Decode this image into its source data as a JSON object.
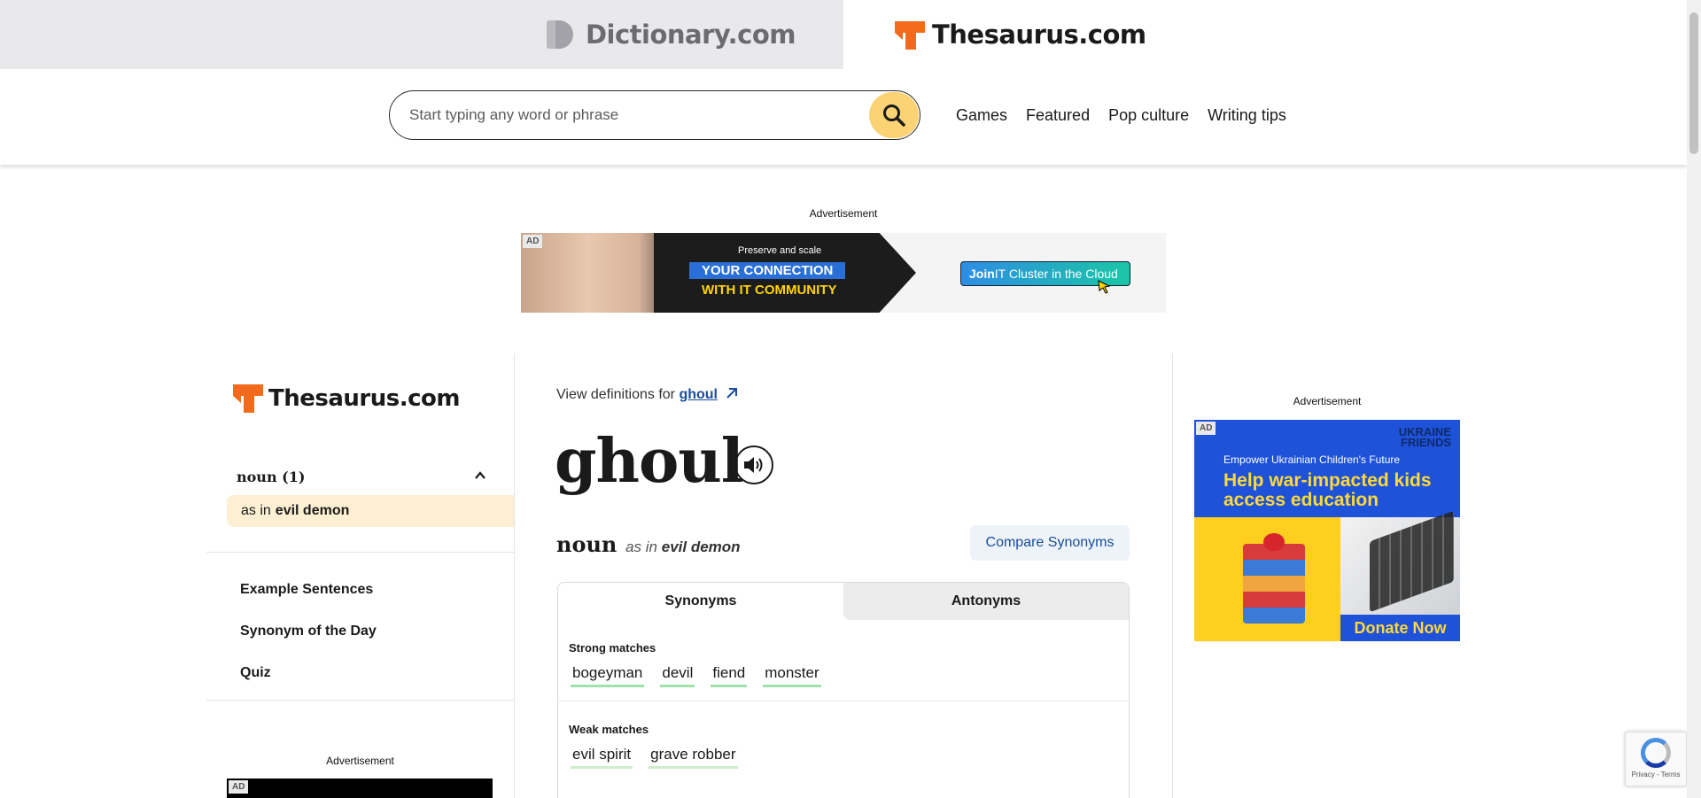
{
  "site_tabs": {
    "dictionary": "Dictionary.com",
    "thesaurus": "Thesaurus.com"
  },
  "search": {
    "placeholder": "Start typing any word or phrase"
  },
  "nav": [
    "Games",
    "Featured",
    "Pop culture",
    "Writing tips"
  ],
  "ads": {
    "label": "Advertisement",
    "badge": "AD",
    "top_banner": {
      "line1": "Preserve and scale",
      "line2": "YOUR CONNECTION",
      "line3": "WITH IT COMMUNITY",
      "cta_bold": "Join",
      "cta_rest": " IT Cluster in the Cloud"
    },
    "right_banner": {
      "logo": "UKRAINE FRIENDS",
      "tagline": "Empower Ukrainian Children's Future",
      "headline": "Help war-impacted kids access education",
      "cta": "Donate Now"
    }
  },
  "sidebar": {
    "logo": "Thesaurus.com",
    "pos_heading": "noun (1)",
    "sense_prefix": "as in",
    "sense_term": "evil demon",
    "links": [
      "Example Sentences",
      "Synonym of the Day",
      "Quiz"
    ]
  },
  "entry": {
    "view_definitions_prefix": "View definitions for",
    "word": "ghoul",
    "part_of_speech": "noun",
    "sense_prefix": "as in",
    "sense_term": "evil demon",
    "compare_button": "Compare Synonyms",
    "tabs": [
      "Synonyms",
      "Antonyms"
    ],
    "strong_title": "Strong matches",
    "strong_matches": [
      "bogeyman",
      "devil",
      "fiend",
      "monster"
    ],
    "weak_title": "Weak matches",
    "weak_matches": [
      "evil spirit",
      "grave robber"
    ]
  },
  "recaptcha": {
    "links": "Privacy - Terms"
  },
  "colors": {
    "brand_orange": "#f26b1d",
    "search_button": "#fcd374",
    "link_blue": "#1a4d9b",
    "strong_underline": "#9fe2a9",
    "sense_highlight": "#fcefd2"
  }
}
